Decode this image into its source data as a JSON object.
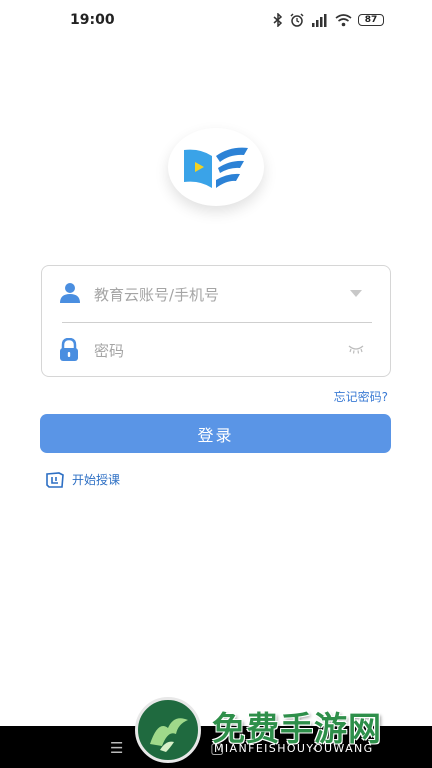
{
  "status_bar": {
    "time": "19:00",
    "battery": "87"
  },
  "login": {
    "account_placeholder": "教育云账号/手机号",
    "password_placeholder": "密码",
    "forgot_password": "忘记密码?",
    "login_button": "登录",
    "start_teaching": "开始授课"
  },
  "watermark": {
    "title": "免费手游网",
    "subtitle": "MIANFEISHOUYOUWANG"
  },
  "colors": {
    "primary": "#5a95e6",
    "link": "#3b7bd4",
    "watermark_green": "#2e8f4a"
  },
  "icons": {
    "account": "user-icon",
    "password": "lock-icon",
    "dropdown": "chevron-down-icon",
    "visibility": "eye-closed-icon",
    "teach": "teach-icon",
    "logo": "app-logo"
  }
}
